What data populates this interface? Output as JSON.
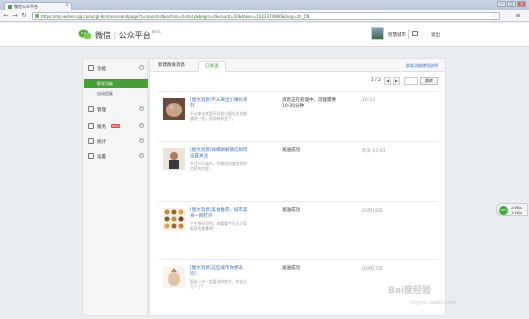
{
  "browser": {
    "tab_title": "微信公众平台",
    "url": "https://mp.weixin.qq.com/cgi-bin/masssendpage?t=mass/list&action=history&begin=0&count=10&token=1022374890&lang=zh_CN",
    "window_controls": [
      "—",
      "□",
      "✕"
    ]
  },
  "header": {
    "brand": "微信",
    "brand_sub": "公众平台",
    "beta": "BETA",
    "account_name": "智慧城市",
    "logout": "退出"
  },
  "sidebar": {
    "groups": [
      {
        "label": "功能",
        "icon": "function-icon",
        "expand": "−"
      },
      {
        "label": "管理",
        "icon": "manage-icon",
        "expand": "+"
      },
      {
        "label": "服务",
        "icon": "service-icon",
        "expand": "+",
        "badge": "NEW"
      },
      {
        "label": "统计",
        "icon": "stats-icon",
        "expand": "+"
      },
      {
        "label": "设置",
        "icon": "settings-icon",
        "expand": "+"
      }
    ],
    "sub_items": [
      "群发功能",
      "自动回复"
    ]
  },
  "main": {
    "tabs": [
      "新建群发消息",
      "已发送"
    ],
    "help_link": "群发功能使用说明",
    "pager": {
      "page": "1 / 2",
      "prev": "◀",
      "next": "▶",
      "jump": "跳转"
    },
    "rows": [
      {
        "title": "[图文消息]不从来出小镇长系列",
        "desc": "不从来出来是不同发小镇长文化都建地一些，现场有机会了。",
        "status": "消息正在处理中，可能需要10-20分钟",
        "date": "16:23"
      },
      {
        "title": "[图文消息]详细讲解微信如何设置关注",
        "desc": "关注什么城市，并想如何变成你的信息的内容...",
        "status": "发送成功",
        "date": "昨天 15:43"
      },
      {
        "title": "[图文消息]美食推荐，城市美食一网打尽",
        "desc": "下午茶时间到，来看看今天为大家推荐的美食吧！",
        "status": "发送成功",
        "date": "03月18日"
      },
      {
        "title": "[图文消息]这些城市你想去吗？",
        "desc": "据说一生一定要去的地方，你去过几个了？",
        "status": "发送成功",
        "date": "03月17日"
      }
    ]
  },
  "widget": {
    "percent": "59%",
    "up": "2.6K/s",
    "down": "1.2K/s"
  },
  "watermark": {
    "main": "Bai度经验",
    "sub": "jingyan.baidu.com"
  }
}
